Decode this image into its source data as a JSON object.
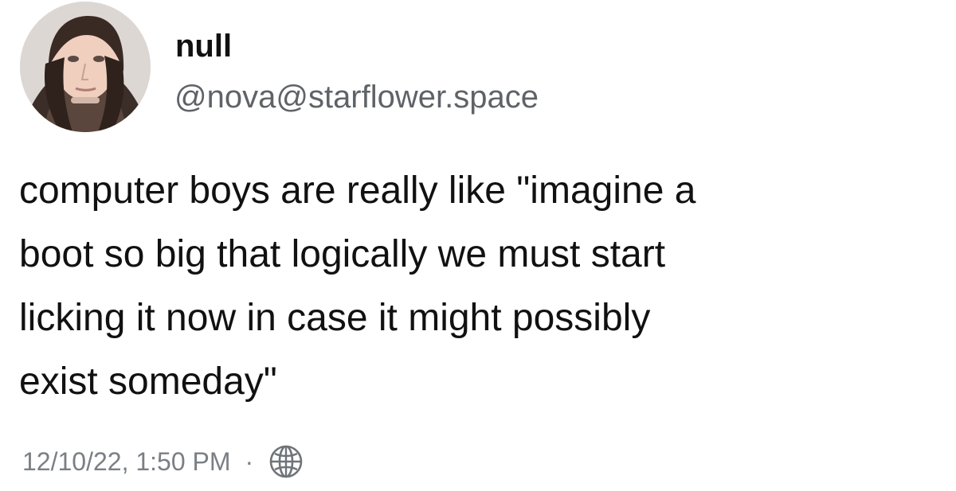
{
  "post": {
    "author": {
      "display_name": "null",
      "handle": "@nova@starflower.space",
      "avatar_icon": "user-avatar-photo"
    },
    "content_lines": [
      "computer boys are really like \"imagine a",
      "boot so big that logically we must start",
      "licking it now in case it might possibly",
      "exist someday\""
    ],
    "timestamp": "12/10/22, 1:50 PM",
    "separator": "·",
    "visibility_icon": "globe-icon"
  },
  "colors": {
    "text_primary": "#111111",
    "text_secondary": "#5f6368",
    "meta_text": "#7a7f85",
    "background": "#ffffff"
  }
}
